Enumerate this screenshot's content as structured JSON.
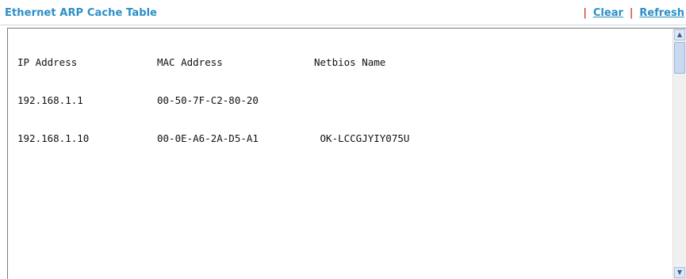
{
  "header": {
    "title": "Ethernet ARP Cache Table",
    "separator": "|",
    "clear_label": "Clear",
    "refresh_label": "Refresh"
  },
  "table": {
    "columns": [
      "IP Address",
      "MAC Address",
      "Netbios Name"
    ],
    "rows": [
      [
        "192.168.1.1",
        "00-50-7F-C2-80-20",
        ""
      ],
      [
        "192.168.1.10",
        "00-0E-A6-2A-D5-A1",
        " OK-LCCGJYIY075U"
      ]
    ]
  },
  "colors": {
    "title": "#2a8fc7",
    "link": "#2a8fc7",
    "separator": "#cc0000",
    "text": "#111111"
  },
  "icons": {
    "scroll_up": "arrow-up-icon",
    "scroll_down": "arrow-down-icon"
  }
}
